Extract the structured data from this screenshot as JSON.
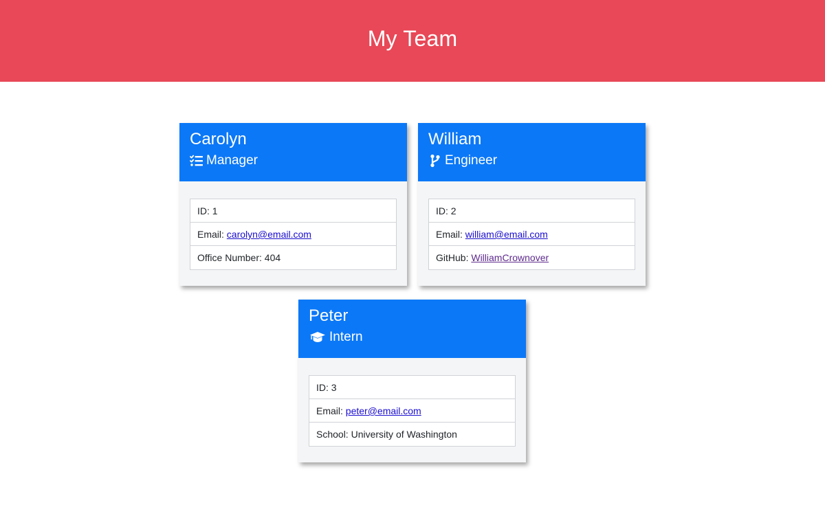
{
  "header": {
    "title": "My Team"
  },
  "colors": {
    "header_bg": "#e84857",
    "card_head_bg": "#0b78f7"
  },
  "cards": [
    {
      "name": "Carolyn",
      "role": "Manager",
      "role_icon": "tasks-icon",
      "items": [
        {
          "label": "ID: ",
          "value": "1"
        },
        {
          "label": "Email: ",
          "value": "carolyn@email.com"
        },
        {
          "label": "Office Number: ",
          "value": "404"
        }
      ]
    },
    {
      "name": "William",
      "role": "Engineer",
      "role_icon": "code-branch-icon",
      "items": [
        {
          "label": "ID: ",
          "value": "2"
        },
        {
          "label": "Email: ",
          "value": "william@email.com"
        },
        {
          "label": "GitHub: ",
          "value": "WilliamCrownover"
        }
      ]
    },
    {
      "name": "Peter",
      "role": "Intern",
      "role_icon": "graduation-cap-icon",
      "items": [
        {
          "label": "ID: ",
          "value": "3"
        },
        {
          "label": "Email: ",
          "value": "peter@email.com"
        },
        {
          "label": "School: ",
          "value": "University of Washington"
        }
      ]
    }
  ]
}
